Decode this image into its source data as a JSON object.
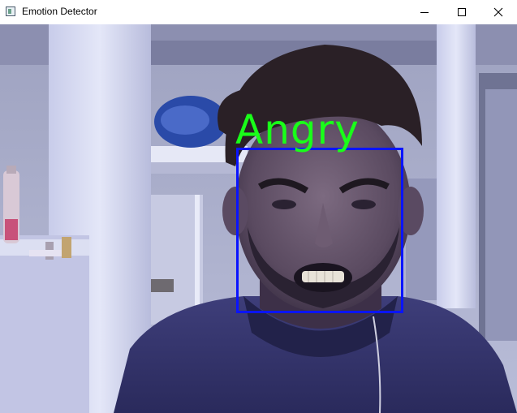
{
  "window": {
    "title": "Emotion Detector",
    "icons": {
      "app": "app-window-icon",
      "minimize": "minimize-icon",
      "maximize": "maximize-icon",
      "close": "close-icon"
    }
  },
  "detection": {
    "emotion": "Angry",
    "label_color": "#19ff19",
    "box_color": "#0a14ff"
  }
}
